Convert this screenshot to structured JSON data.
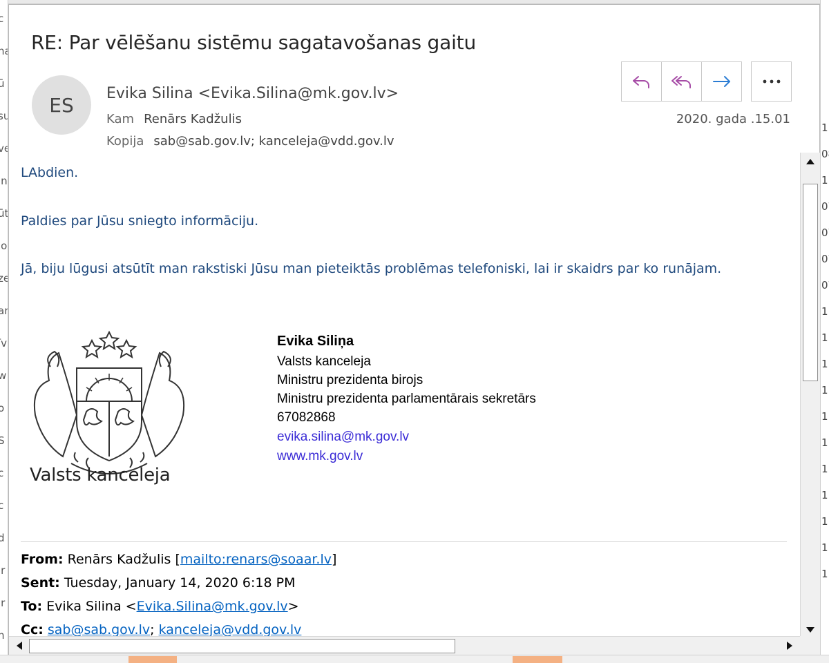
{
  "background": {
    "left_fragments": [
      "c",
      "na",
      "ū",
      "su",
      "ve",
      "ln",
      "ūt",
      "lo",
      "ze",
      "ar",
      "īv",
      "w",
      "o",
      "S",
      "c",
      "c",
      "d",
      "ir",
      "ir",
      "n"
    ],
    "right_fragments": [
      "1",
      "08",
      "1",
      "07",
      "07",
      "07",
      "07",
      "1",
      "1",
      "1",
      "1",
      "1",
      "1",
      "1",
      "1",
      "1",
      "1",
      "1"
    ]
  },
  "email": {
    "subject": "RE: Par vēlēšanu sistēmu sagatavošanas gaitu",
    "avatar_initials": "ES",
    "sender": "Evika Silina <Evika.Silina@mk.gov.lv>",
    "to_label": "Kam",
    "to_value": "Renārs Kadžulis",
    "cc_label": "Kopija",
    "cc_value": "sab@sab.gov.lv; kanceleja@vdd.gov.lv",
    "date": "2020.  gada .15.01",
    "body": [
      "LAbdien.",
      "Paldies par Jūsu sniegto informāciju.",
      "Jā, biju lūgusi atsūtīt man rakstiski Jūsu man pieteiktās problēmas telefoniski, lai ir skaidrs par ko runājam."
    ],
    "logo_text": "Valsts kanceleja",
    "signature": {
      "name": "Evika Siliņa",
      "line1": "Valsts kanceleja",
      "line2": "Ministru prezidenta birojs",
      "line3": "Ministru prezidenta parlamentārais sekretārs",
      "phone": "67082868",
      "email": "evika.silina@mk.gov.lv",
      "web": "www.mk.gov.lv"
    },
    "quoted": {
      "from_label": "From:",
      "from_name": "Renārs Kadžulis",
      "from_link": "mailto:renars@soaar.lv",
      "sent_label": "Sent:",
      "sent_value": "Tuesday, January 14, 2020 6:18 PM",
      "to_label": "To:",
      "to_name": "Evika Silina",
      "to_link": "Evika.Silina@mk.gov.lv",
      "cc_label": "Cc:",
      "cc_link1": "sab@sab.gov.lv",
      "cc_link2": "kanceleja@vdd.gov.lv"
    }
  },
  "colors": {
    "body_text": "#1f497d",
    "reply_icon": "#a64ca6",
    "forward_icon": "#2b7cd3",
    "link": "#0563c1",
    "signature_link": "#3a2bd6"
  },
  "icons": {
    "reply": "reply-icon",
    "reply_all": "reply-all-icon",
    "forward": "forward-icon",
    "more": "more-icon"
  }
}
